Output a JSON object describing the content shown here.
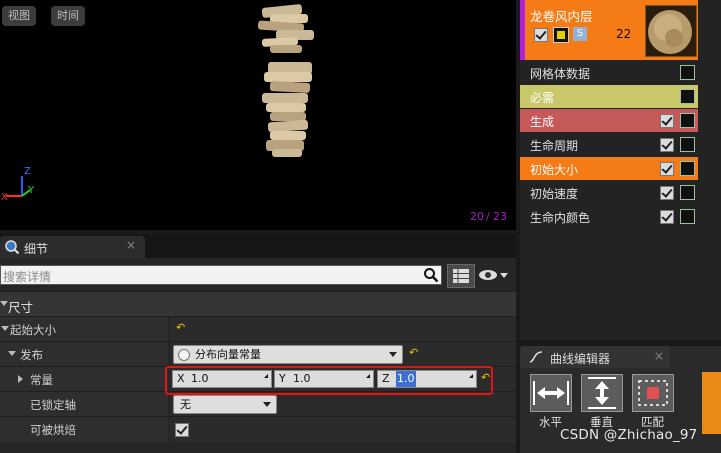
{
  "viewport": {
    "buttons": [
      "视图",
      "时间"
    ],
    "axis_labels": {
      "x": "X",
      "y": "Y",
      "z": "Z"
    },
    "particle_count": "20",
    "particle_total": "23",
    "particle_separator": "/"
  },
  "details": {
    "tab_label": "细节",
    "close_glyph": "×",
    "search_placeholder": "搜索详情",
    "rows": {
      "category": "尺寸",
      "initial_size": "起始大小",
      "distribution": "发布",
      "distribution_value": "分布向量常量",
      "constant": "常量",
      "locked_axes": "已锁定轴",
      "locked_axes_value": "无",
      "can_bake": "可被烘焙"
    },
    "vector": {
      "x_label": "X",
      "x_value": "1.0",
      "y_label": "Y",
      "y_value": "1.0",
      "z_label": "Z",
      "z_value": "1.0"
    },
    "reset_glyph": "↶"
  },
  "emitter": {
    "name": "龙卷风内层",
    "count": "22",
    "mode_badge": "S",
    "modules": [
      {
        "label": "网格体数据",
        "color": "#232323",
        "text_color": "#e0e0e0",
        "checkbox": false
      },
      {
        "label": "必需",
        "color": "#c8c86a",
        "text_color": "#ffffff",
        "checkbox": false
      },
      {
        "label": "生成",
        "color": "#c65a5a",
        "text_color": "#ffffff",
        "checkbox": true
      },
      {
        "label": "生命周期",
        "color": "#232323",
        "text_color": "#e0e0e0",
        "checkbox": true
      },
      {
        "label": "初始大小",
        "color": "#f47b16",
        "text_color": "#ffffff",
        "checkbox": true
      },
      {
        "label": "初始速度",
        "color": "#232323",
        "text_color": "#e0e0e0",
        "checkbox": true
      },
      {
        "label": "生命内颜色",
        "color": "#232323",
        "text_color": "#e0e0e0",
        "checkbox": true
      }
    ]
  },
  "curve_editor": {
    "tab_label": "曲线编辑器",
    "close_glyph": "×",
    "buttons": [
      {
        "label": "水平",
        "icon": "horizontal-fit-icon"
      },
      {
        "label": "垂直",
        "icon": "vertical-fit-icon"
      },
      {
        "label": "匹配",
        "icon": "fit-icon"
      }
    ]
  },
  "watermark": "CSDN @Zhichao_97",
  "colors": {
    "accent_orange": "#f47b16",
    "emitter_stripe": "#b022d8",
    "highlight_red": "#e01515",
    "reset_yellow": "#e6c200"
  }
}
